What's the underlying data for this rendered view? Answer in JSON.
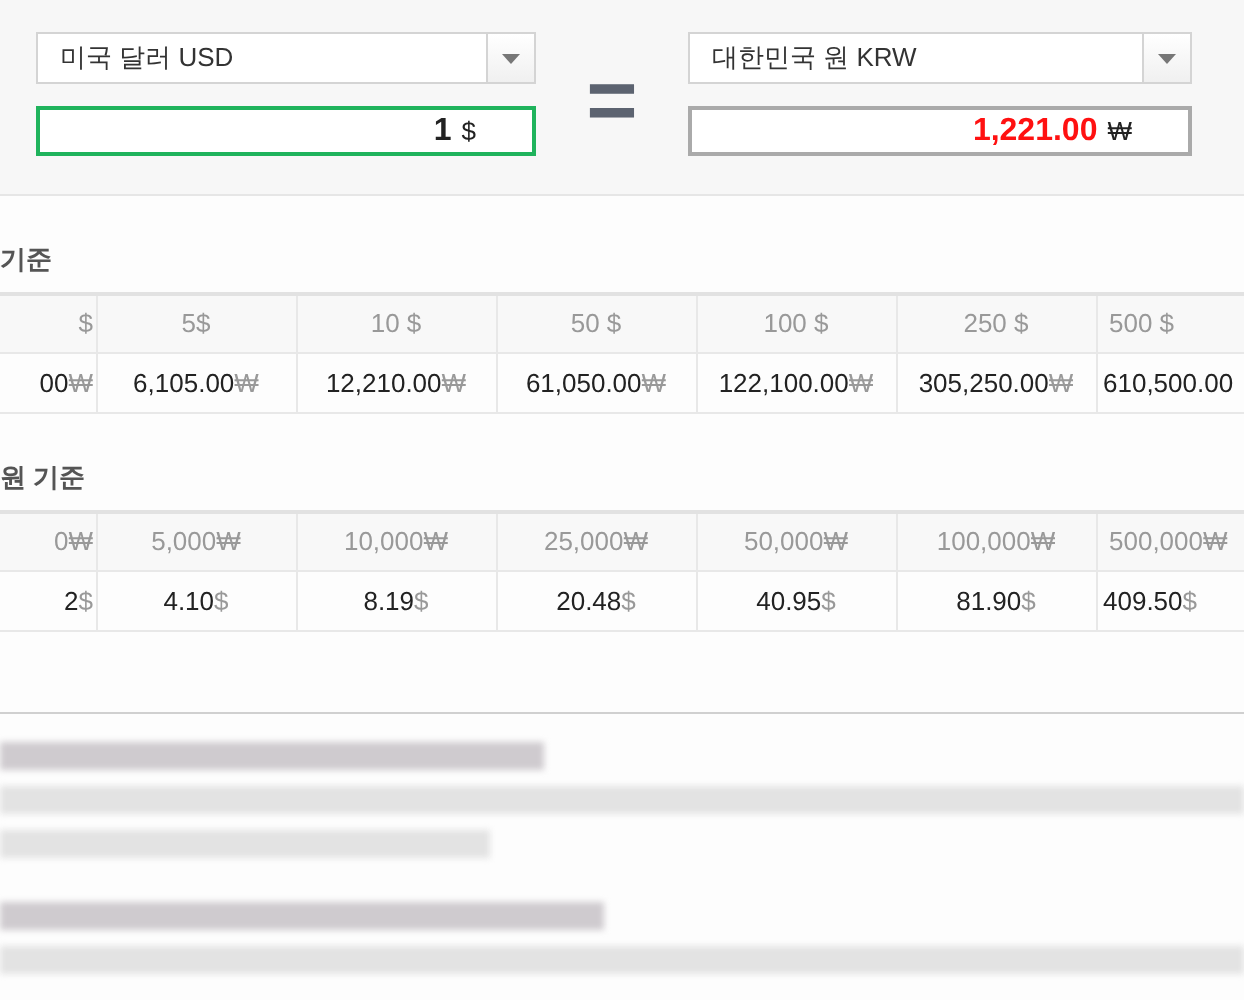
{
  "converter": {
    "from": {
      "currency": "미국 달러 USD",
      "amount": "1",
      "unit": "$"
    },
    "equals": "=",
    "to": {
      "currency": "대한민국 원 KRW",
      "amount": "1,221.00",
      "unit": "₩"
    }
  },
  "tables": [
    {
      "title": "기준",
      "headers": [
        "$",
        "5$",
        "10 $",
        "50 $",
        "100 $",
        "250 $",
        "500 $"
      ],
      "cells": [
        {
          "value": "00",
          "unit": "₩"
        },
        {
          "value": "6,105.00",
          "unit": "₩"
        },
        {
          "value": "12,210.00",
          "unit": "₩"
        },
        {
          "value": "61,050.00",
          "unit": "₩"
        },
        {
          "value": "122,100.00",
          "unit": "₩"
        },
        {
          "value": "305,250.00",
          "unit": "₩"
        },
        {
          "value": "610,500.00"
        }
      ]
    },
    {
      "title": "원 기준",
      "headers": [
        "0₩",
        "5,000₩",
        "10,000₩",
        "25,000₩",
        "50,000₩",
        "100,000₩",
        "500,000₩"
      ],
      "cells": [
        {
          "value": "2",
          "unit": "$"
        },
        {
          "value": "4.10",
          "unit": "$"
        },
        {
          "value": "8.19",
          "unit": "$"
        },
        {
          "value": "20.48",
          "unit": "$"
        },
        {
          "value": "40.95",
          "unit": "$"
        },
        {
          "value": "81.90",
          "unit": "$"
        },
        {
          "value": "409.50",
          "unit": "$"
        }
      ]
    }
  ]
}
